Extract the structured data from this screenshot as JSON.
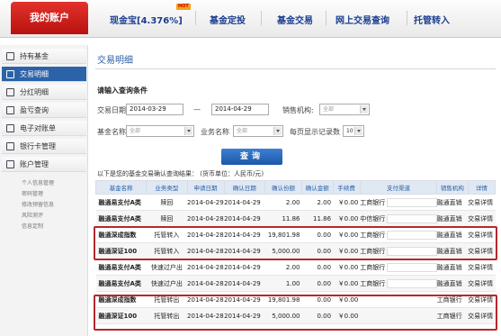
{
  "nav": {
    "my_account": "我的账户",
    "items": [
      "现金宝[4.376%]",
      "基金定投",
      "基金交易",
      "网上交易查询",
      "托管转入"
    ],
    "hot_badge": "HOT"
  },
  "sidebar": {
    "items": [
      "持有基金",
      "交易明细",
      "分红明细",
      "盈亏查询",
      "电子对账单",
      "银行卡管理",
      "账户管理"
    ],
    "sub_items": [
      "个人信息管理",
      "密码管理",
      "修改预留信息",
      "风险测评",
      "信息定制"
    ]
  },
  "main": {
    "title": "交易明细",
    "cond_title": "请输入查询条件",
    "date_label": "交易日期",
    "date_from": "2014-03-29",
    "date_sep": "—",
    "date_to": "2014-04-29",
    "sales_org_label": "销售机构:",
    "sales_org_value": "全部",
    "fund_name_label": "基金名称",
    "fund_name_value": "全部",
    "biz_label": "业务名称",
    "biz_value": "全部",
    "per_page_label": "每页显示记录数",
    "per_page_value": "10",
    "search_label": "查询",
    "result_note": "以下是您的基金交易确认查询结果： (货币单位：人民币/元)"
  },
  "table": {
    "headers": [
      "基金名称",
      "业务类型",
      "申请日期",
      "确认日期",
      "确认份额",
      "确认金额",
      "手续费",
      "支付渠道",
      "销售机构",
      "详情"
    ],
    "rows": [
      [
        "融通易支付A类",
        "赎回",
        "2014-04-29",
        "2014-04-29",
        "2.00",
        "2.00",
        "￥0.00",
        "工商银行",
        "融通直销",
        "交易详情"
      ],
      [
        "融通易支付A类",
        "赎回",
        "2014-04-28",
        "2014-04-29",
        "11.86",
        "11.86",
        "￥0.00",
        "中信银行",
        "融通直销",
        "交易详情"
      ],
      [
        "融通深成指数",
        "托管转入",
        "2014-04-28",
        "2014-04-29",
        "19,801.98",
        "0.00",
        "￥0.00",
        "工商银行",
        "融通直销",
        "交易详情"
      ],
      [
        "融通深证100",
        "托管转入",
        "2014-04-28",
        "2014-04-29",
        "5,000.00",
        "0.00",
        "￥0.00",
        "工商银行",
        "融通直销",
        "交易详情"
      ],
      [
        "融通易支付A类",
        "快速过户出",
        "2014-04-28",
        "2014-04-29",
        "2.00",
        "0.00",
        "￥0.00",
        "工商银行",
        "融通直销",
        "交易详情"
      ],
      [
        "融通易支付A类",
        "快速过户出",
        "2014-04-28",
        "2014-04-29",
        "1.00",
        "0.00",
        "￥0.00",
        "工商银行",
        "融通直销",
        "交易详情"
      ],
      [
        "融通深成指数",
        "托管转出",
        "2014-04-28",
        "2014-04-29",
        "19,801.98",
        "0.00",
        "￥0.00",
        "",
        "工商银行",
        "交易详情"
      ],
      [
        "融通深证100",
        "托管转出",
        "2014-04-28",
        "2014-04-29",
        "5,000.00",
        "0.00",
        "￥0.00",
        "",
        "工商银行",
        "交易详情"
      ]
    ]
  },
  "colors": {
    "brand_red": "#c8201b",
    "link_blue": "#1a3d8f",
    "highlight": "#b5282c"
  }
}
